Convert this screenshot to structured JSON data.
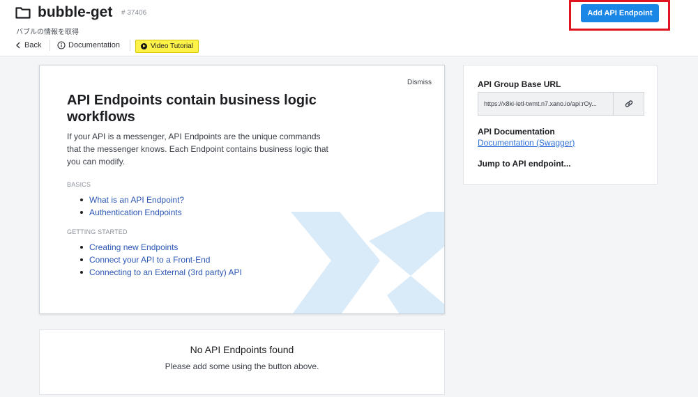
{
  "header": {
    "title": "bubble-get",
    "group_id": "# 37406",
    "subtitle": "バブルの情報を取得",
    "back_label": "Back",
    "docs_label": "Documentation",
    "video_label": "Video Tutorial",
    "add_button_label": "Add API Endpoint",
    "folder_icon": "folder-icon",
    "accent_color": "#1a87e6",
    "video_button_color": "#fff34a",
    "highlight_color": "#e0141e"
  },
  "info_card": {
    "dismiss_label": "Dismiss",
    "heading": "API Endpoints contain business logic workflows",
    "description": "If your API is a messenger, API Endpoints are the unique commands that the messenger knows. Each Endpoint contains business logic that you can modify.",
    "sections": [
      {
        "label": "BASICS",
        "links": [
          "What is an API Endpoint?",
          "Authentication Endpoints"
        ]
      },
      {
        "label": "GETTING STARTED",
        "links": [
          "Creating new Endpoints",
          "Connect your API to a Front-End",
          "Connecting to an External (3rd party) API"
        ]
      }
    ]
  },
  "empty_state": {
    "title": "No API Endpoints found",
    "message": "Please add some using the button above."
  },
  "side_panel": {
    "base_url_heading": "API Group Base URL",
    "base_url": "https://x8ki-letl-twmt.n7.xano.io/api:rOy...",
    "api_docs_heading": "API Documentation",
    "api_docs_link": "Documentation (Swagger)",
    "jump_heading": "Jump to API endpoint..."
  }
}
